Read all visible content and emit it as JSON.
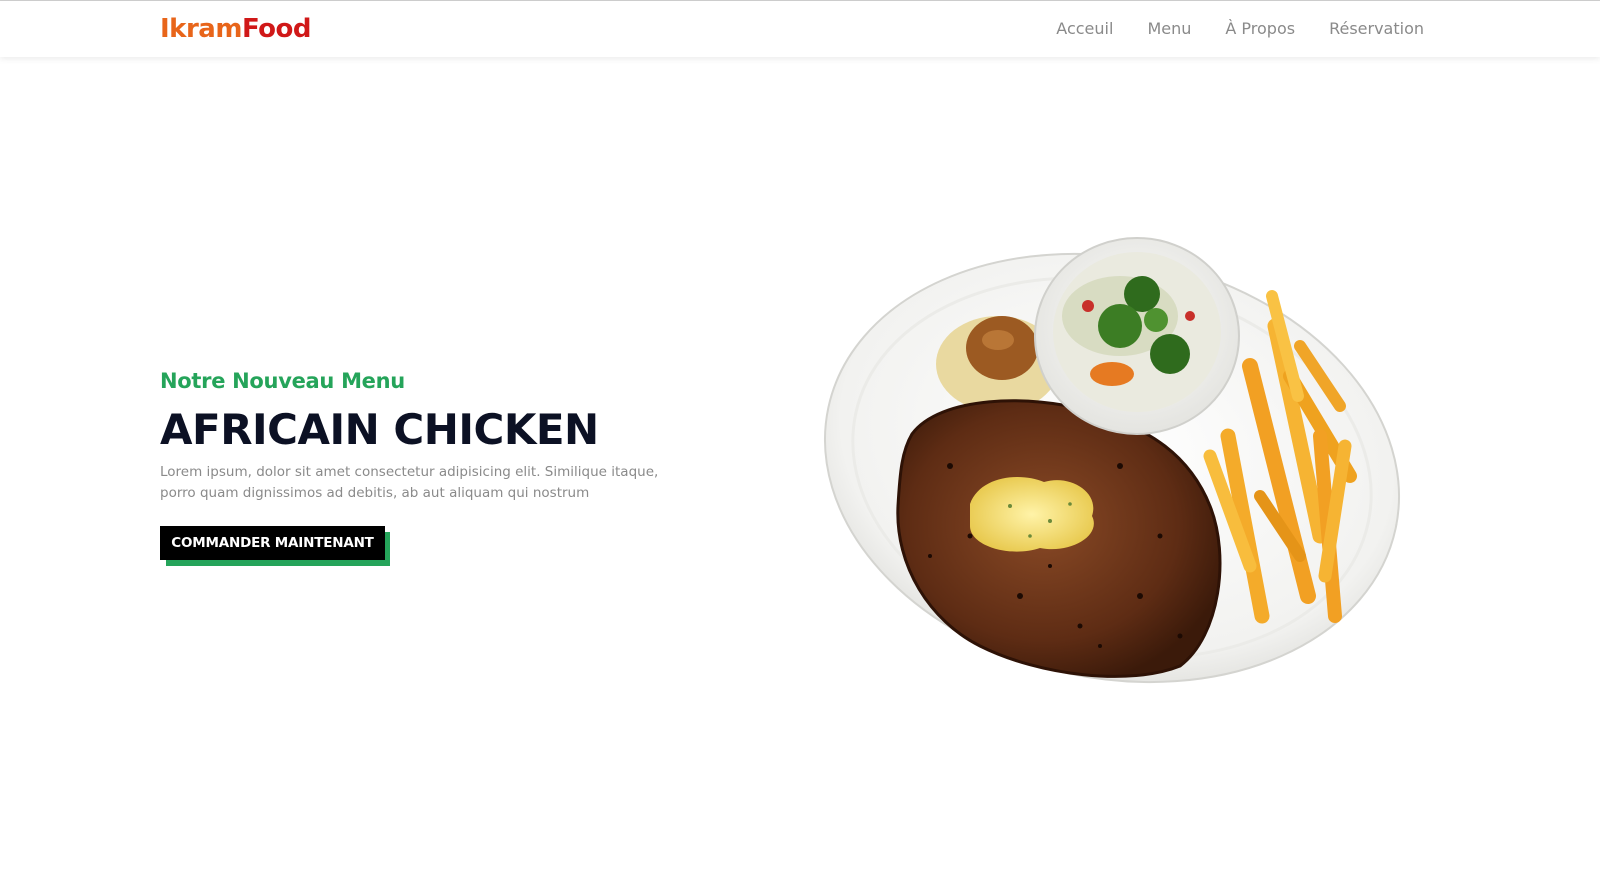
{
  "brand": {
    "part1": "Ikram",
    "part2": "Food",
    "color1": "#e8651a",
    "color2": "#d01818"
  },
  "nav": {
    "items": [
      {
        "label": "Acceuil"
      },
      {
        "label": "Menu"
      },
      {
        "label": "À Propos"
      },
      {
        "label": "Réservation"
      }
    ]
  },
  "hero": {
    "kicker": "Notre Nouveau Menu",
    "title": "AFRICAIN CHICKEN",
    "description": "Lorem ipsum, dolor sit amet consectetur adipisicing elit. Similique itaque, porro quam dignissimos ad debitis, ab aut aliquam qui nostrum",
    "cta_label": "COMMANDER MAINTENANT",
    "accent_color": "#25a45a",
    "image_icon": "steak-plate-image"
  }
}
